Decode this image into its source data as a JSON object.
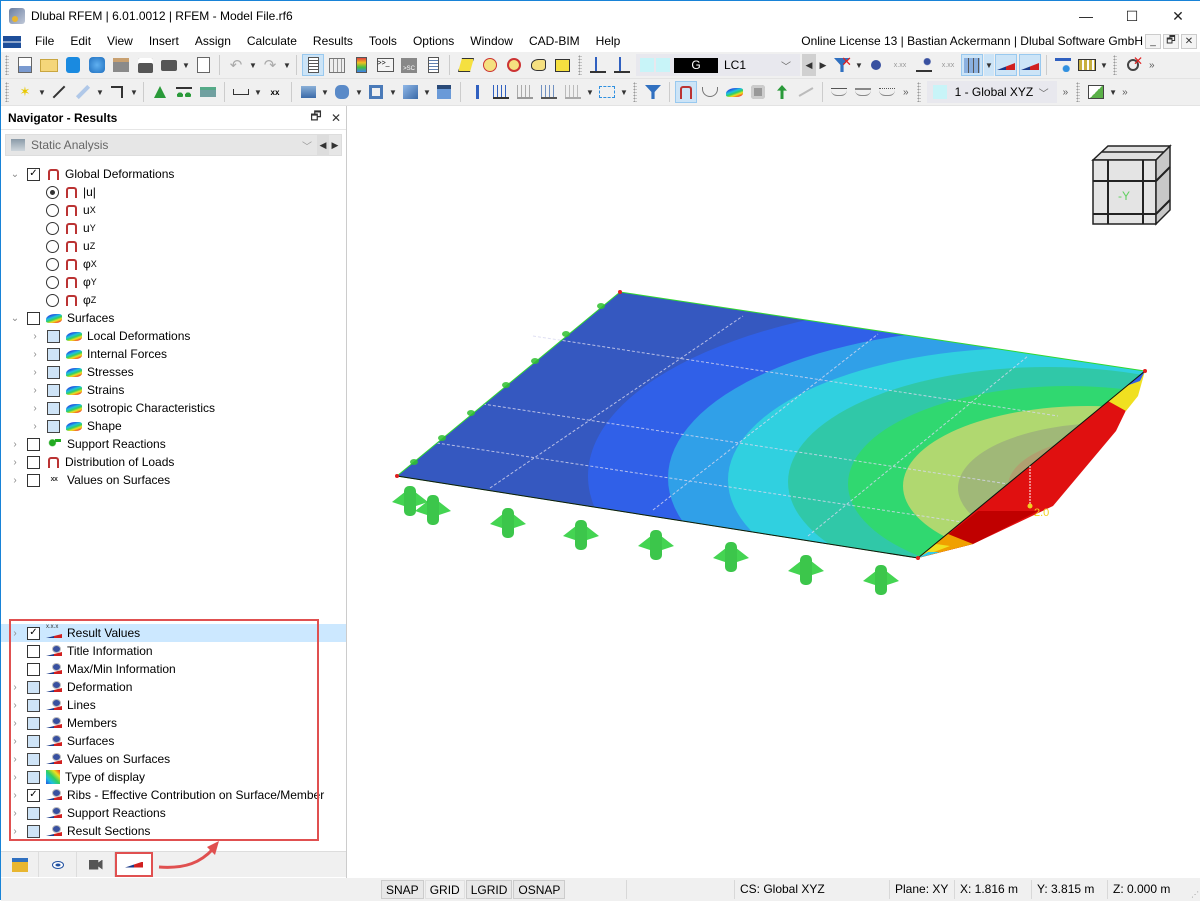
{
  "window": {
    "title": "Dlubal RFEM | 6.01.0012 | RFEM - Model File.rf6",
    "minimize": "—",
    "maximize": "☐",
    "close": "✕"
  },
  "menu": {
    "items": [
      "File",
      "Edit",
      "View",
      "Insert",
      "Assign",
      "Calculate",
      "Results",
      "Tools",
      "Options",
      "Window",
      "CAD-BIM",
      "Help"
    ],
    "license": "Online License 13 | Bastian Ackermann | Dlubal Software GmbH",
    "mdi_min": "_",
    "mdi_restore": "🗗",
    "mdi_close": "✕"
  },
  "toolbar": {
    "load_case_type": "G",
    "load_case": "LC1",
    "coord_system": "1 - Global XYZ"
  },
  "navigator": {
    "title": "Navigator - Results",
    "pin": "🗗",
    "close": "✕",
    "analysis": "Static Analysis",
    "global_deformations": "Global Deformations",
    "deformation_options": [
      {
        "main": "|u|",
        "sub": "",
        "selected": true
      },
      {
        "main": "u",
        "sub": "X",
        "selected": false
      },
      {
        "main": "u",
        "sub": "Y",
        "selected": false
      },
      {
        "main": "u",
        "sub": "Z",
        "selected": false
      },
      {
        "main": "φ",
        "sub": "X",
        "selected": false
      },
      {
        "main": "φ",
        "sub": "Y",
        "selected": false
      },
      {
        "main": "φ",
        "sub": "Z",
        "selected": false
      }
    ],
    "surfaces": "Surfaces",
    "surface_items": [
      "Local Deformations",
      "Internal Forces",
      "Stresses",
      "Strains",
      "Isotropic Characteristics",
      "Shape"
    ],
    "support_reactions": "Support Reactions",
    "distribution_of_loads": "Distribution of Loads",
    "values_on_surfaces": "Values on Surfaces",
    "display_items": [
      {
        "label": "Result Values",
        "state": "checked",
        "expandable": true,
        "icon": "result-values-icon"
      },
      {
        "label": "Title Information",
        "state": "unchecked",
        "expandable": false,
        "icon": "display-eye-icon"
      },
      {
        "label": "Max/Min Information",
        "state": "unchecked",
        "expandable": false,
        "icon": "display-eye-icon"
      },
      {
        "label": "Deformation",
        "state": "partial",
        "expandable": true,
        "icon": "display-eye-icon"
      },
      {
        "label": "Lines",
        "state": "partial",
        "expandable": true,
        "icon": "display-eye-icon"
      },
      {
        "label": "Members",
        "state": "partial",
        "expandable": true,
        "icon": "display-eye-icon"
      },
      {
        "label": "Surfaces",
        "state": "partial",
        "expandable": true,
        "icon": "display-eye-icon"
      },
      {
        "label": "Values on Surfaces",
        "state": "partial",
        "expandable": true,
        "icon": "display-eye-icon"
      },
      {
        "label": "Type of display",
        "state": "partial",
        "expandable": true,
        "icon": "color-scale-icon"
      },
      {
        "label": "Ribs - Effective Contribution on Surface/Member",
        "state": "checked",
        "expandable": true,
        "icon": "display-eye-icon"
      },
      {
        "label": "Support Reactions",
        "state": "partial",
        "expandable": true,
        "icon": "display-eye-icon"
      },
      {
        "label": "Result Sections",
        "state": "partial",
        "expandable": true,
        "icon": "display-eye-icon"
      }
    ]
  },
  "viewport": {
    "result_label": "2.0",
    "view_cube_label": "-Y"
  },
  "statusbar": {
    "snap": "SNAP",
    "grid": "GRID",
    "lgrid": "LGRID",
    "osnap": "OSNAP",
    "cs": "CS: Global XYZ",
    "plane": "Plane: XY",
    "x": "X: 1.816 m",
    "y": "Y: 3.815 m",
    "z": "Z: 0.000 m"
  },
  "colors": {
    "accent": "#1883d7",
    "highlight_box": "#e05050",
    "selection": "#cce8ff"
  }
}
